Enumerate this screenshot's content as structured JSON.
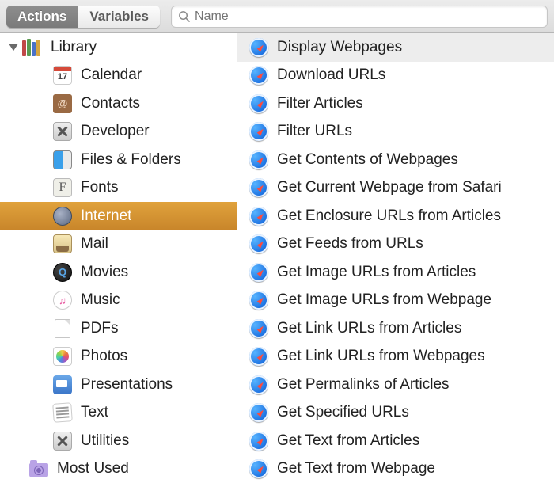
{
  "toolbar": {
    "tab_actions": "Actions",
    "tab_variables": "Variables",
    "search_placeholder": "Name"
  },
  "sidebar": {
    "library_label": "Library",
    "items": [
      {
        "label": "Calendar",
        "icon": "calendar"
      },
      {
        "label": "Contacts",
        "icon": "contacts"
      },
      {
        "label": "Developer",
        "icon": "developer"
      },
      {
        "label": "Files & Folders",
        "icon": "finder"
      },
      {
        "label": "Fonts",
        "icon": "font"
      },
      {
        "label": "Internet",
        "icon": "internet",
        "selected": true
      },
      {
        "label": "Mail",
        "icon": "mail"
      },
      {
        "label": "Movies",
        "icon": "quicktime"
      },
      {
        "label": "Music",
        "icon": "music"
      },
      {
        "label": "PDFs",
        "icon": "pdf"
      },
      {
        "label": "Photos",
        "icon": "photos"
      },
      {
        "label": "Presentations",
        "icon": "keynote"
      },
      {
        "label": "Text",
        "icon": "text"
      },
      {
        "label": "Utilities",
        "icon": "utilities"
      }
    ],
    "most_used_label": "Most Used"
  },
  "actions": [
    {
      "label": "Display Webpages",
      "selected": true
    },
    {
      "label": "Download URLs"
    },
    {
      "label": "Filter Articles"
    },
    {
      "label": "Filter URLs"
    },
    {
      "label": "Get Contents of Webpages"
    },
    {
      "label": "Get Current Webpage from Safari"
    },
    {
      "label": "Get Enclosure URLs from Articles"
    },
    {
      "label": "Get Feeds from URLs"
    },
    {
      "label": "Get Image URLs from Articles"
    },
    {
      "label": "Get Image URLs from Webpage"
    },
    {
      "label": "Get Link URLs from Articles"
    },
    {
      "label": "Get Link URLs from Webpages"
    },
    {
      "label": "Get Permalinks of Articles"
    },
    {
      "label": "Get Specified URLs"
    },
    {
      "label": "Get Text from Articles"
    },
    {
      "label": "Get Text from Webpage"
    }
  ]
}
